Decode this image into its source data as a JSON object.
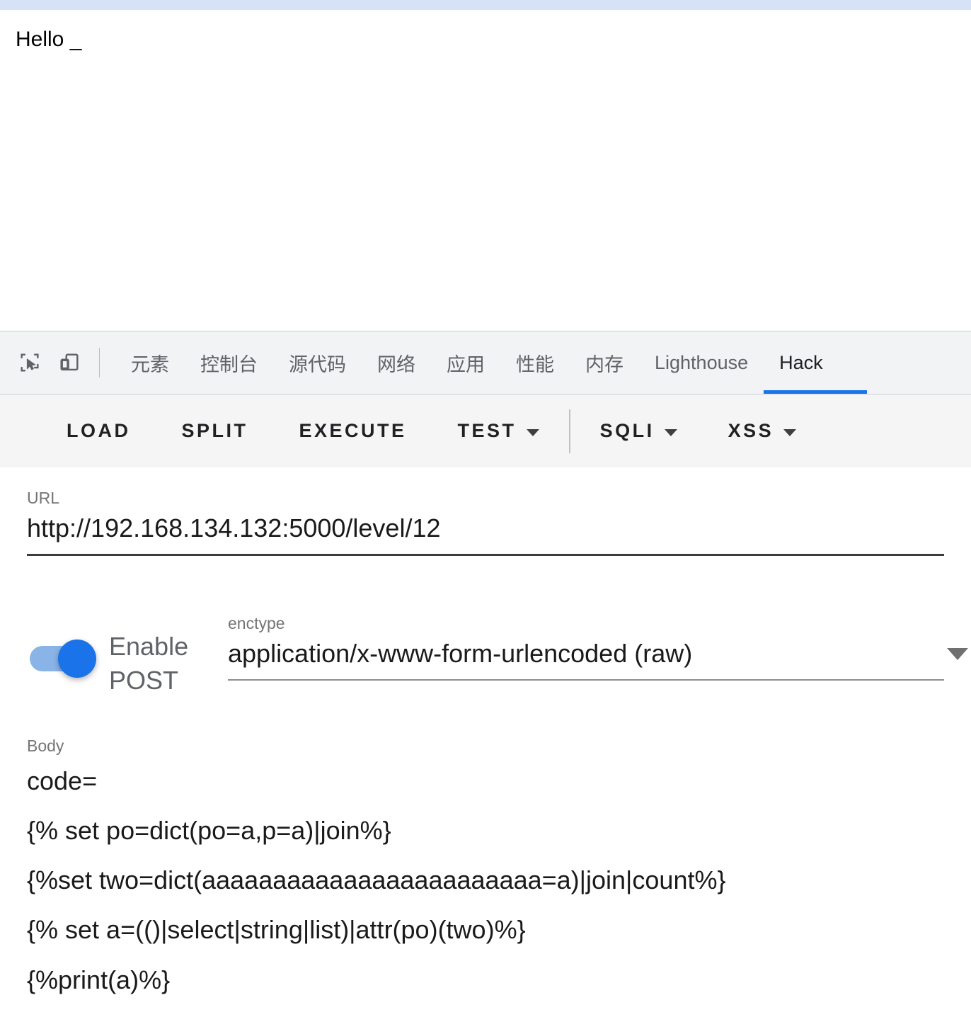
{
  "page": {
    "content_text": "Hello _",
    "top_bar_color": "#d6e3f7"
  },
  "devtools": {
    "icons": {
      "inspect": "inspect-element-icon",
      "device": "device-toolbar-icon"
    },
    "tabs": [
      {
        "label": "元素",
        "active": false
      },
      {
        "label": "控制台",
        "active": false
      },
      {
        "label": "源代码",
        "active": false
      },
      {
        "label": "网络",
        "active": false
      },
      {
        "label": "应用",
        "active": false
      },
      {
        "label": "性能",
        "active": false
      },
      {
        "label": "内存",
        "active": false
      },
      {
        "label": "Lighthouse",
        "active": false
      },
      {
        "label": "Hack",
        "active": true
      }
    ],
    "active_tab_underline_color": "#1a73e8"
  },
  "toolbar": {
    "load_label": "LOAD",
    "split_label": "SPLIT",
    "execute_label": "EXECUTE",
    "test_label": "TEST",
    "sqli_label": "SQLI",
    "xss_label": "XSS"
  },
  "form": {
    "url_label": "URL",
    "url_value": "http://192.168.134.132:5000/level/12",
    "post_toggle_label": "Enable POST",
    "post_toggle_on": true,
    "toggle_color": "#1a73e8",
    "enctype_label": "enctype",
    "enctype_value": "application/x-www-form-urlencoded (raw)",
    "body_label": "Body",
    "body_lines": [
      "code=",
      "{% set po=dict(po=a,p=a)|join%}",
      "{%set two=dict(aaaaaaaaaaaaaaaaaaaaaaaa=a)|join|count%}",
      "{% set a=(()|select|string|list)|attr(po)(two)%}",
      "{%print(a)%}"
    ]
  }
}
